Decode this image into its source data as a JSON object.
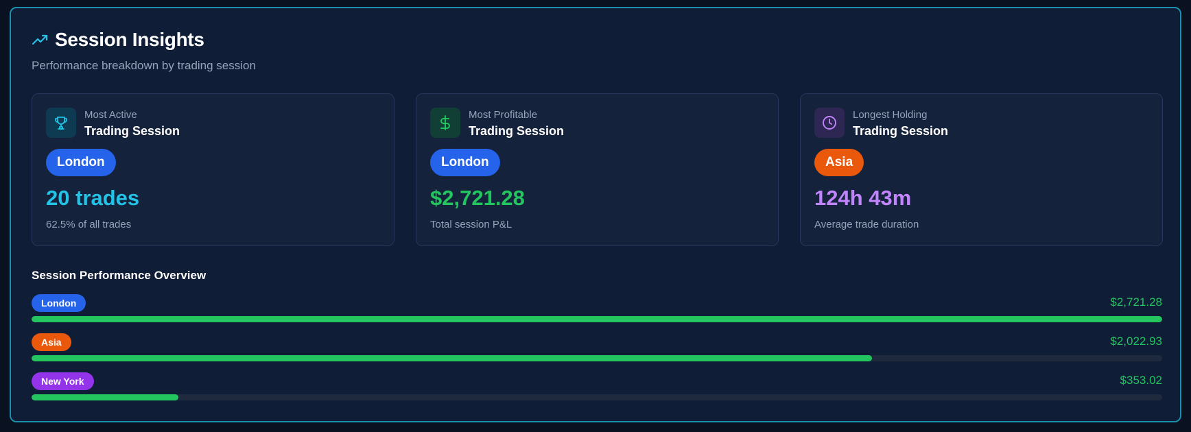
{
  "header": {
    "title": "Session Insights",
    "subtitle": "Performance breakdown by trading session",
    "icon": "trending-up-icon",
    "accent_color": "#22c3e6"
  },
  "cards": [
    {
      "icon": "trophy-icon",
      "kicker": "Most Active",
      "heading": "Trading Session",
      "session": "London",
      "session_color": "#2563eb",
      "value": "20 trades",
      "value_color": "#22c3e6",
      "note": "62.5% of all trades"
    },
    {
      "icon": "dollar-icon",
      "kicker": "Most Profitable",
      "heading": "Trading Session",
      "session": "London",
      "session_color": "#2563eb",
      "value": "$2,721.28",
      "value_color": "#22c55e",
      "note": "Total session P&L"
    },
    {
      "icon": "clock-icon",
      "kicker": "Longest Holding",
      "heading": "Trading Session",
      "session": "Asia",
      "session_color": "#ea580c",
      "value": "124h 43m",
      "value_color": "#c084fc",
      "note": "Average trade duration"
    }
  ],
  "overview": {
    "title": "Session Performance Overview",
    "rows": [
      {
        "session": "London",
        "session_color": "#2563eb",
        "amount": "$2,721.28",
        "fraction": 1.0
      },
      {
        "session": "Asia",
        "session_color": "#ea580c",
        "amount": "$2,022.93",
        "fraction": 0.7434
      },
      {
        "session": "New York",
        "session_color": "#9333ea",
        "amount": "$353.02",
        "fraction": 0.1297
      }
    ]
  }
}
